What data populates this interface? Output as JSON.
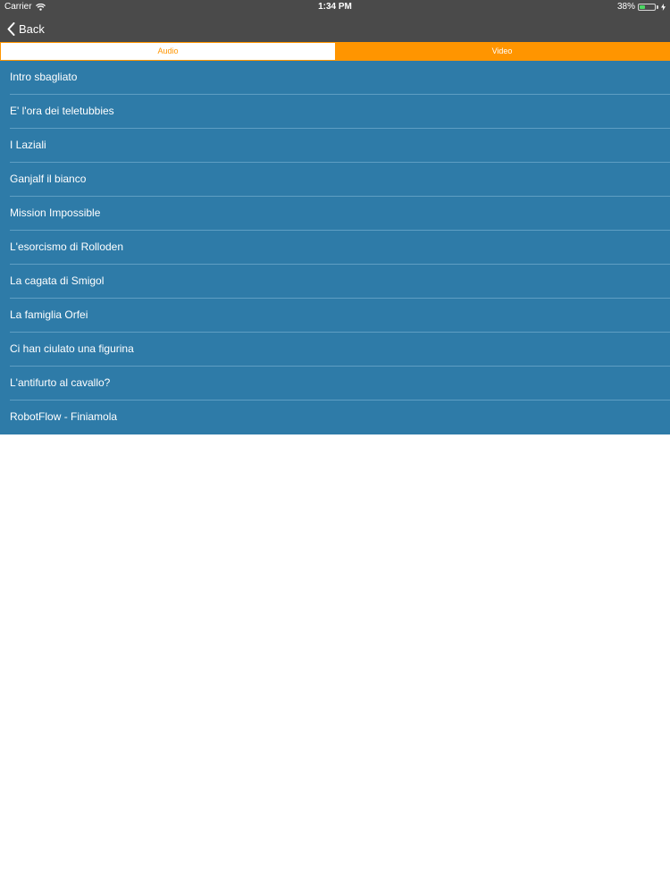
{
  "status_bar": {
    "carrier": "Carrier",
    "time": "1:34 PM",
    "battery_percent": "38%",
    "battery_level": 0.38,
    "wifi_icon": "wifi-icon",
    "battery_icon": "battery-icon",
    "charging_icon": "charging-bolt-icon"
  },
  "nav": {
    "back_label": "Back",
    "back_icon": "chevron-left-icon"
  },
  "segments": {
    "audio_label": "Audio",
    "video_label": "Video",
    "selected": "video",
    "accent_color": "#ff9500"
  },
  "list": {
    "background_color": "#2e7ba8",
    "items": [
      {
        "label": "Intro sbagliato"
      },
      {
        "label": "E' l'ora dei teletubbies"
      },
      {
        "label": "I Laziali"
      },
      {
        "label": "Ganjalf il bianco"
      },
      {
        "label": "Mission Impossible"
      },
      {
        "label": "L'esorcismo di Rolloden"
      },
      {
        "label": "La cagata di Smigol"
      },
      {
        "label": "La famiglia Orfei"
      },
      {
        "label": "Ci han ciulato una figurina"
      },
      {
        "label": "L'antifurto al cavallo?"
      },
      {
        "label": "RobotFlow - Finiamola"
      }
    ]
  }
}
